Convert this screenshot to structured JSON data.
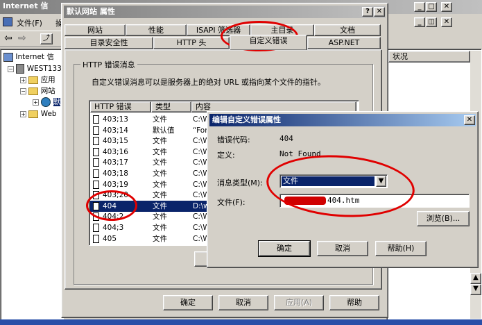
{
  "bg_window": {
    "title": "Internet 信",
    "menu_file": "文件(F)",
    "menu_more": "操",
    "tree": [
      {
        "label": "Internet 信"
      },
      {
        "label": "WEST1338"
      },
      {
        "label": "应用"
      },
      {
        "label": "网站"
      },
      {
        "label": "默"
      },
      {
        "label": "Web"
      }
    ],
    "status_header": "状况"
  },
  "props_dialog": {
    "title": "默认网站 属性",
    "help_glyph": "?",
    "close_glyph": "✕",
    "tabs_row1": [
      "网站",
      "性能",
      "ISAPI 筛选器",
      "主目录",
      "文档"
    ],
    "tabs_row2": [
      "目录安全性",
      "HTTP 头",
      "自定义错误",
      "ASP.NET"
    ],
    "group_title": "HTTP 错误消息",
    "description": "自定义错误消息可以是服务器上的绝对 URL 或指向某个文件的指针。",
    "columns": [
      "HTTP 错误",
      "类型",
      "内容"
    ],
    "rows": [
      {
        "code": "403;13",
        "type": "文件",
        "content": "C:\\W"
      },
      {
        "code": "403;14",
        "type": "默认值",
        "content": "“For"
      },
      {
        "code": "403;15",
        "type": "文件",
        "content": "C:\\W"
      },
      {
        "code": "403;16",
        "type": "文件",
        "content": "C:\\W"
      },
      {
        "code": "403;17",
        "type": "文件",
        "content": "C:\\W"
      },
      {
        "code": "403;18",
        "type": "文件",
        "content": "C:\\W"
      },
      {
        "code": "403;19",
        "type": "文件",
        "content": "C:\\W"
      },
      {
        "code": "403;20",
        "type": "文件",
        "content": "C:\\W"
      },
      {
        "code": "404",
        "type": "文件",
        "content": "D:\\w",
        "selected": true
      },
      {
        "code": "404;2",
        "type": "文件",
        "content": "C:\\W"
      },
      {
        "code": "404;3",
        "type": "文件",
        "content": "C:\\W"
      },
      {
        "code": "405",
        "type": "文件",
        "content": "C:\\W"
      }
    ],
    "ok": "确定",
    "cancel": "取消",
    "apply": "应用(A)",
    "apply_key": "A",
    "help": "帮助"
  },
  "edit_dialog": {
    "title": "编辑自定义错误属性",
    "close_glyph": "✕",
    "code_label": "错误代码:",
    "code_value": "404",
    "def_label": "定义:",
    "def_value": "Not Found",
    "msgtype_label": "消息类型(M):",
    "msgtype_value": "文件",
    "file_label": "文件(F):",
    "file_value": "404.htm",
    "browse": "浏览(B)...",
    "ok": "确定",
    "cancel": "取消",
    "help": "帮助(H)"
  },
  "colors": {
    "active_title": "#0a246a",
    "selection": "#0a246a",
    "annotation": "#e00000"
  }
}
